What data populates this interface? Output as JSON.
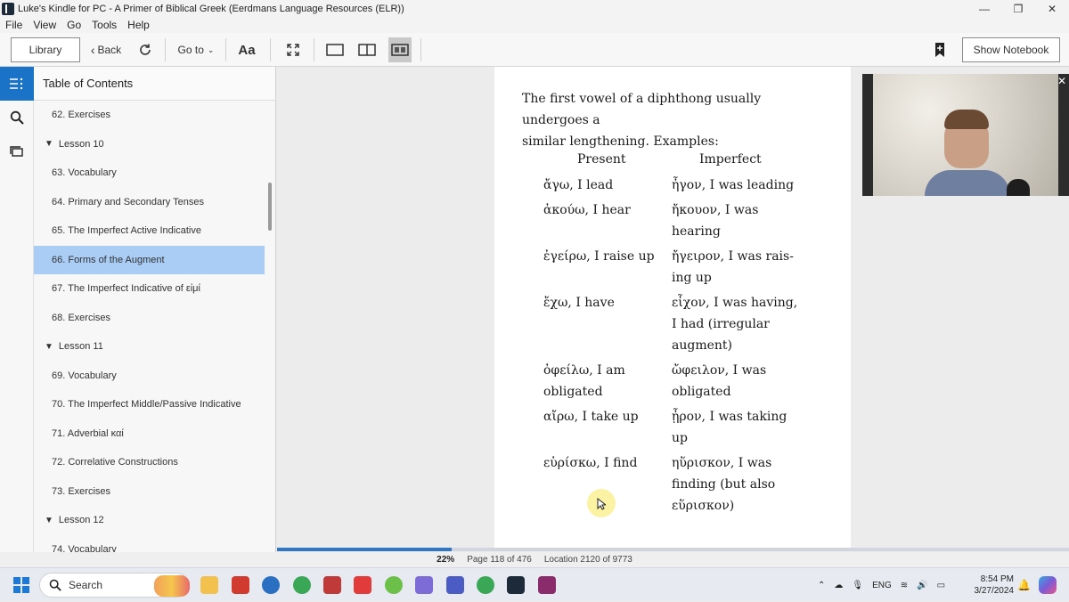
{
  "window": {
    "title": "Luke's Kindle for PC - A Primer of Biblical Greek (Eerdmans Language Resources (ELR))",
    "minimize": "—",
    "maximize": "❐",
    "close": "✕"
  },
  "menu": [
    "File",
    "View",
    "Go",
    "Tools",
    "Help"
  ],
  "toolbar": {
    "library": "Library",
    "back": "Back",
    "goto": "Go to",
    "font": "Aa",
    "show_notebook": "Show Notebook"
  },
  "toc": {
    "header": "Table of Contents",
    "items": [
      {
        "label": "62. Exercises",
        "kind": "sub"
      },
      {
        "label": "Lesson 10",
        "kind": "lesson"
      },
      {
        "label": "63. Vocabulary",
        "kind": "sub"
      },
      {
        "label": "64. Primary and Secondary Tenses",
        "kind": "sub"
      },
      {
        "label": "65. The Imperfect Active Indicative",
        "kind": "sub"
      },
      {
        "label": "66. Forms of the Augment",
        "kind": "sub",
        "selected": true
      },
      {
        "label": "67. The Imperfect Indicative of εἰμί",
        "kind": "sub"
      },
      {
        "label": "68. Exercises",
        "kind": "sub"
      },
      {
        "label": "Lesson 11",
        "kind": "lesson"
      },
      {
        "label": "69. Vocabulary",
        "kind": "sub"
      },
      {
        "label": "70. The Imperfect Middle/Passive Indicative",
        "kind": "sub"
      },
      {
        "label": "71. Adverbial καί",
        "kind": "sub"
      },
      {
        "label": "72. Correlative Constructions",
        "kind": "sub"
      },
      {
        "label": "73. Exercises",
        "kind": "sub"
      },
      {
        "label": "Lesson 12",
        "kind": "lesson"
      },
      {
        "label": "74. Vocabulary",
        "kind": "sub"
      }
    ]
  },
  "page": {
    "intro_line1": "The first vowel of a diphthong usually undergoes a",
    "intro_line2": "similar lengthening. Examples:",
    "col_present": "Present",
    "col_imperfect": "Imperfect",
    "rows": [
      {
        "present": [
          "ἄγω, I lead"
        ],
        "imperfect": [
          "ἦγον, I was leading"
        ]
      },
      {
        "present": [
          "ἀκούω, I hear"
        ],
        "imperfect": [
          "ἤκουον, I was",
          "hearing"
        ]
      },
      {
        "present": [
          "ἐγείρω, I raise up"
        ],
        "imperfect": [
          "ἤγειρον, I was rais-",
          "ing up"
        ]
      },
      {
        "present": [
          "ἔχω, I have"
        ],
        "imperfect": [
          "εἶχον, I was having,",
          "I had (irregular",
          "augment)"
        ]
      },
      {
        "present": [
          "ὀφείλω, I am",
          "obligated"
        ],
        "imperfect": [
          "ὤφειλον, I was",
          "obligated"
        ]
      },
      {
        "present": [
          "αἴρω, I take up"
        ],
        "imperfect": [
          "ᾖρον, I was taking",
          "up"
        ]
      },
      {
        "present": [
          "εὑρίσκω, I find"
        ],
        "imperfect": [
          "ηὕρισκον, I was",
          "finding (but also",
          "εὕρισκον)"
        ]
      }
    ]
  },
  "reading_progress": 0.22,
  "status": {
    "percent": "22%",
    "page": "Page 118 of 476",
    "location": "Location 2120 of 9773"
  },
  "taskbar": {
    "search": "Search",
    "lang": "ENG",
    "time": "8:54 PM",
    "date": "3/27/2024"
  },
  "colors": {
    "accent": "#1b73c8",
    "selected_row": "#a9cdf5",
    "progress": "#2f76c9"
  }
}
